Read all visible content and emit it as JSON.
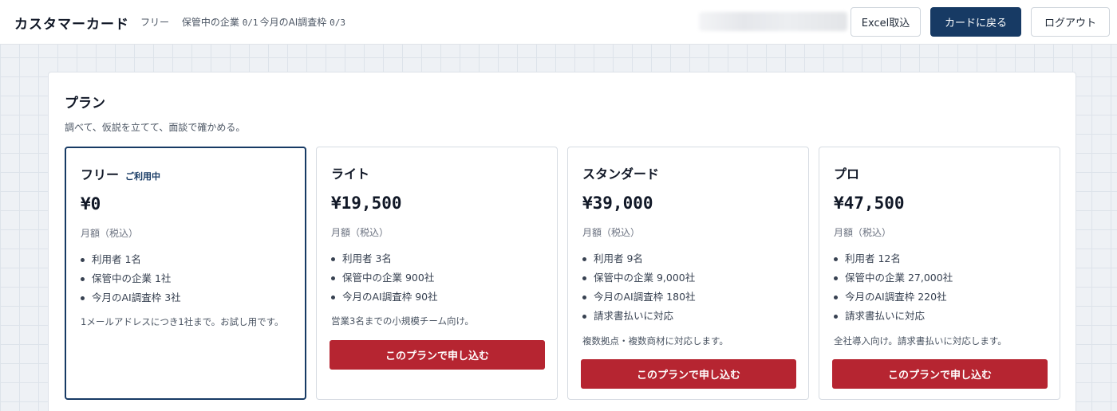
{
  "header": {
    "brand": "カスタマーカード",
    "plan_label": "フリー",
    "companies_label": "保管中の企業",
    "companies_count": "0/1",
    "ai_label": "今月のAI調査枠",
    "ai_count": "0/3",
    "buttons": {
      "excel": "Excel取込",
      "back": "カードに戻る",
      "logout": "ログアウト"
    }
  },
  "panel": {
    "title": "プラン",
    "subtitle": "調べて、仮説を立てて、面談で確かめる。"
  },
  "plans": [
    {
      "name": "フリー",
      "badge": "ご利用中",
      "price": "¥0",
      "period": "月額（税込）",
      "features": [
        "利用者 1名",
        "保管中の企業 1社",
        "今月のAI調査枠 3社"
      ],
      "note": "1メールアドレスにつき1社まで。お試し用です。",
      "cta": ""
    },
    {
      "name": "ライト",
      "badge": "",
      "price": "¥19,500",
      "period": "月額（税込）",
      "features": [
        "利用者 3名",
        "保管中の企業 900社",
        "今月のAI調査枠 90社"
      ],
      "note": "営業3名までの小規模チーム向け。",
      "cta": "このプランで申し込む"
    },
    {
      "name": "スタンダード",
      "badge": "",
      "price": "¥39,000",
      "period": "月額（税込）",
      "features": [
        "利用者 9名",
        "保管中の企業 9,000社",
        "今月のAI調査枠 180社",
        "請求書払いに対応"
      ],
      "note": "複数拠点・複数商材に対応します。",
      "cta": "このプランで申し込む"
    },
    {
      "name": "プロ",
      "badge": "",
      "price": "¥47,500",
      "period": "月額（税込）",
      "features": [
        "利用者 12名",
        "保管中の企業 27,000社",
        "今月のAI調査枠 220社",
        "請求書払いに対応"
      ],
      "note": "全社導入向け。請求書払いに対応します。",
      "cta": "このプランで申し込む"
    }
  ],
  "colors": {
    "accent_navy": "#173a64",
    "cta_red": "#b62531"
  }
}
